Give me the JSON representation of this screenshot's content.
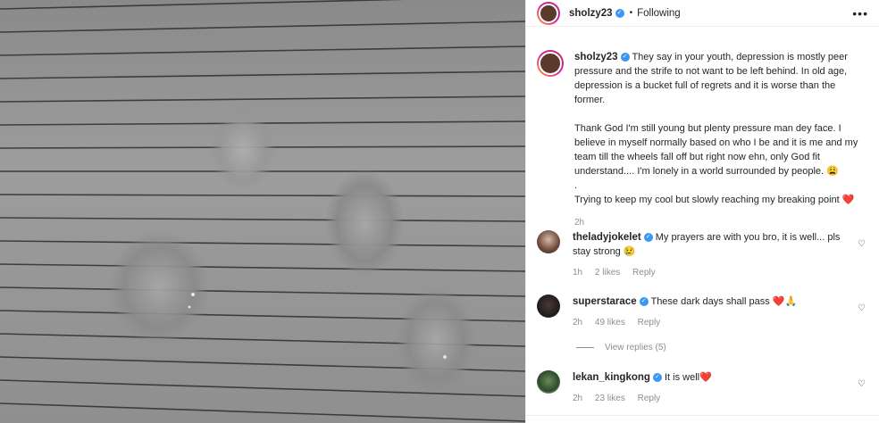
{
  "post": {
    "username": "sholzy23",
    "follow_status": "Following",
    "separator": "•",
    "more_label": "•••"
  },
  "caption": {
    "username": "sholzy23",
    "paragraph1": "They say in your youth, depression is mostly peer pressure and the strife to not want to be left behind. In old age, depression is a bucket full of regrets and it is worse than the former.",
    "paragraph2": "Thank God I'm still young but plenty pressure man dey face. I believe in myself normally based on who I be and it is me and my team till the wheels fall off but right now ehn, only God fit understand.... I'm lonely in a world surrounded by people.",
    "paragraph2_emoji": "😩",
    "dot_line": ".",
    "paragraph3": "Trying to keep my cool but slowly reaching my breaking point",
    "paragraph3_emoji": "❤️",
    "time": "2h"
  },
  "comments": [
    {
      "username": "theladyjokelet",
      "text": "My prayers are with you bro, it is well... pls stay strong",
      "emoji": "😢",
      "time": "1h",
      "likes": "2 likes",
      "reply": "Reply"
    },
    {
      "username": "superstarace",
      "text": "These dark days shall pass",
      "emoji": "❤️🙏",
      "time": "2h",
      "likes": "49 likes",
      "reply": "Reply"
    },
    {
      "username": "lekan_kingkong",
      "text": "It is well",
      "emoji": "❤️",
      "time": "2h",
      "likes": "23 likes",
      "reply": "Reply"
    }
  ],
  "view_replies": "View replies (5)",
  "icons": {
    "verified": "verified-badge-icon",
    "heart": "heart-outline-icon",
    "more": "more-options-icon"
  },
  "colors": {
    "verified": "#3897f0",
    "muted": "#8e8e8e",
    "text": "#262626"
  }
}
